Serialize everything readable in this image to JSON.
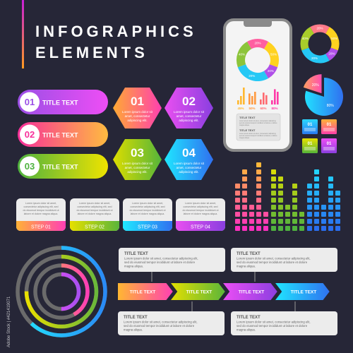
{
  "header": {
    "title_line1": "INFOGRAPHICS",
    "title_line2": "ELEMENTS"
  },
  "colors": {
    "background": "#262637",
    "card": "#ececec",
    "text_dark": "#555555"
  },
  "pills": [
    {
      "num": "01",
      "label": "TITLE TEXT",
      "from": "#9b4fe6",
      "to": "#ee4ef5"
    },
    {
      "num": "02",
      "label": "TITLE TEXT",
      "from": "#f7309a",
      "to": "#ffbb40"
    },
    {
      "num": "03",
      "label": "TITLE TEXT",
      "from": "#4fb23f",
      "to": "#eee300"
    }
  ],
  "hexagons": [
    {
      "num": "01",
      "lines": [
        "Lorem ipsum dolor sit",
        "amet, consectetur",
        "adipiscing elit."
      ],
      "from": "#ffaa33",
      "to": "#ff3fb0"
    },
    {
      "num": "02",
      "lines": [
        "Lorem ipsum dolor sit",
        "amet, consectetur",
        "adipiscing elit."
      ],
      "from": "#e94ff0",
      "to": "#8a3fe0"
    },
    {
      "num": "03",
      "lines": [
        "Lorem ipsum dolor sit",
        "amet, consectetur",
        "adipiscing elit."
      ],
      "from": "#dddd00",
      "to": "#55b53a"
    },
    {
      "num": "04",
      "lines": [
        "Lorem ipsum dolor sit",
        "amet, consectetur",
        "adipiscing elit."
      ],
      "from": "#1fe6ff",
      "to": "#3070f0"
    }
  ],
  "steps": [
    {
      "label": "STEP 01",
      "lines": [
        "Lorem ipsum dolor sit amet,",
        "consectetur adipiscing elit, sed",
        "do eiusmod tempor incididunt ut",
        "labore et dolore magna aliqua."
      ],
      "from": "#ffb236",
      "to": "#ff3fb5"
    },
    {
      "label": "STEP 02",
      "lines": [
        "Lorem ipsum dolor sit amet,",
        "consectetur adipiscing elit, sed",
        "do eiusmod tempor incididunt ut",
        "labore et dolore magna aliqua."
      ],
      "from": "#e6e000",
      "to": "#5ab53a"
    },
    {
      "label": "STEP 03",
      "lines": [
        "Lorem ipsum dolor sit amet,",
        "consectetur adipiscing elit, sed",
        "do eiusmod tempor incididunt ut",
        "labore et dolore magna aliqua."
      ],
      "from": "#1fe8ff",
      "to": "#3070f0"
    },
    {
      "label": "STEP 04",
      "lines": [
        "Lorem ipsum dolor sit amet,",
        "consectetur adipiscing elit, sed",
        "do eiusmod tempor incididunt ut",
        "labore et dolore magna aliqua."
      ],
      "from": "#e94ff0",
      "to": "#8a3fe0"
    }
  ],
  "phone": {
    "donut": [
      {
        "label": "20%",
        "from": 330,
        "to": 30,
        "color": "#ff5fa0"
      },
      {
        "label": "50%",
        "from": 30,
        "to": 110,
        "color": "#ffd21f"
      },
      {
        "label": "20%",
        "from": 110,
        "to": 150,
        "color": "#b04fe8"
      },
      {
        "label": "20%",
        "from": 150,
        "to": 250,
        "color": "#25c8f5"
      },
      {
        "label": "40%",
        "from": 250,
        "to": 330,
        "color": "#8cc43a"
      }
    ],
    "bar_groups": [
      {
        "label": "45%",
        "color": "#ffb830",
        "values": [
          0.25,
          0.5,
          1.0
        ]
      },
      {
        "label": "50%",
        "color": "#ff9a40",
        "values": [
          0.65,
          0.5,
          0.75
        ]
      },
      {
        "label": "60%",
        "color": "#ff6a70",
        "values": [
          0.3,
          0.7,
          0.55
        ]
      },
      {
        "label": "80%",
        "color": "#ff3aa8",
        "values": [
          0.25,
          0.9,
          0.75
        ]
      }
    ],
    "text_blocks": [
      {
        "title": "TITLE TEXT",
        "lines": [
          "Lorem ipsum dolor sit amet, consectetur adipiscing",
          "sed do eiusmod tempor incididunt ut labore et dolore",
          "magna aliqua."
        ]
      },
      {
        "title": "TITLE TEXT",
        "lines": [
          "Lorem ipsum dolor sit amet, consectetur adipiscing",
          "sed do eiusmod tempor incididunt ut labore et dolore",
          "magna aliqua."
        ]
      }
    ]
  },
  "side_donut": [
    {
      "label": "20%",
      "from": 330,
      "to": 30,
      "color": "#ff7a8a"
    },
    {
      "label": "50%",
      "from": 30,
      "to": 110,
      "color": "#ffd21f"
    },
    {
      "label": "20%",
      "from": 110,
      "to": 150,
      "color": "#b04fe8"
    },
    {
      "label": "20%",
      "from": 150,
      "to": 250,
      "color": "#25c8f5"
    },
    {
      "label": "40%",
      "from": 250,
      "to": 330,
      "color": "#a8cc2a"
    }
  ],
  "pie": [
    {
      "label": "20%",
      "value": 20,
      "color": "#ff6aa0",
      "exploded": true
    },
    {
      "label": "80%",
      "value": 80,
      "color": "#2aa8f5",
      "exploded": false
    }
  ],
  "tags": [
    {
      "num": "01",
      "from": "#2a7af0",
      "to": "#2ad8ff"
    },
    {
      "num": "01",
      "from": "#ff3fa8",
      "to": "#ffb236"
    },
    {
      "num": "01",
      "from": "#55b53a",
      "to": "#e6e000"
    },
    {
      "num": "01",
      "from": "#8a3fe0",
      "to": "#ee4ef5"
    }
  ],
  "equalizer": {
    "heights": [
      7,
      9,
      4,
      10,
      3,
      9,
      8,
      4,
      7,
      3,
      7,
      9,
      4,
      8,
      6
    ],
    "groups": [
      {
        "bottom": "#ff30c0",
        "top": "#ffb83a"
      },
      {
        "bottom": "#4fb23f",
        "top": "#e8e000"
      },
      {
        "bottom": "#2a6ef0",
        "top": "#22e0ff"
      }
    ]
  },
  "rings": [
    {
      "percent": 62,
      "from": "#2a8af5",
      "to": "#22e8ff"
    },
    {
      "percent": 75,
      "from": "#6ab83a",
      "to": "#e8e000"
    },
    {
      "percent": 42,
      "from": "#ff3fb5",
      "to": "#ffb040"
    },
    {
      "percent": 50,
      "from": "#a84ff0",
      "to": "#ee4ef5"
    }
  ],
  "timeline": {
    "arrows": [
      {
        "label": "TITLE TEXT",
        "from": "#ffb830",
        "to": "#ff3fb5"
      },
      {
        "label": "TITLE TEXT",
        "from": "#e6e000",
        "to": "#5ab53a"
      },
      {
        "label": "TITLE TEXT",
        "from": "#ee4ef5",
        "to": "#8a3fe0"
      },
      {
        "label": "TITLE TEXT",
        "from": "#1fe8ff",
        "to": "#3070f0"
      }
    ],
    "boxes": [
      {
        "title": "TITLE TEXT",
        "lines": [
          "Lorem ipsum dolor sit amet, consectetur adipiscing elit,",
          "sed do eiusmod tempor incididunt ut labore et dolore",
          "magna aliqua."
        ]
      },
      {
        "title": "TITLE TEXT",
        "lines": [
          "Lorem ipsum dolor sit amet, consectetur adipiscing elit,",
          "sed do eiusmod tempor incididunt ut labore et dolore",
          "magna aliqua."
        ]
      },
      {
        "title": "TITLE TEXT",
        "lines": [
          "Lorem ipsum dolor sit amet, consectetur adipiscing elit,",
          "sed do eiusmod tempor incididunt ut labore et dolore",
          "magna aliqua."
        ]
      },
      {
        "title": "TITLE TEXT",
        "lines": [
          "Lorem ipsum dolor sit amet, consectetur adipiscing elit,",
          "sed do eiusmod tempor incididunt ut labore et dolore",
          "magna aliqua."
        ]
      }
    ]
  },
  "watermark": "Adobe Stock | #421419071"
}
